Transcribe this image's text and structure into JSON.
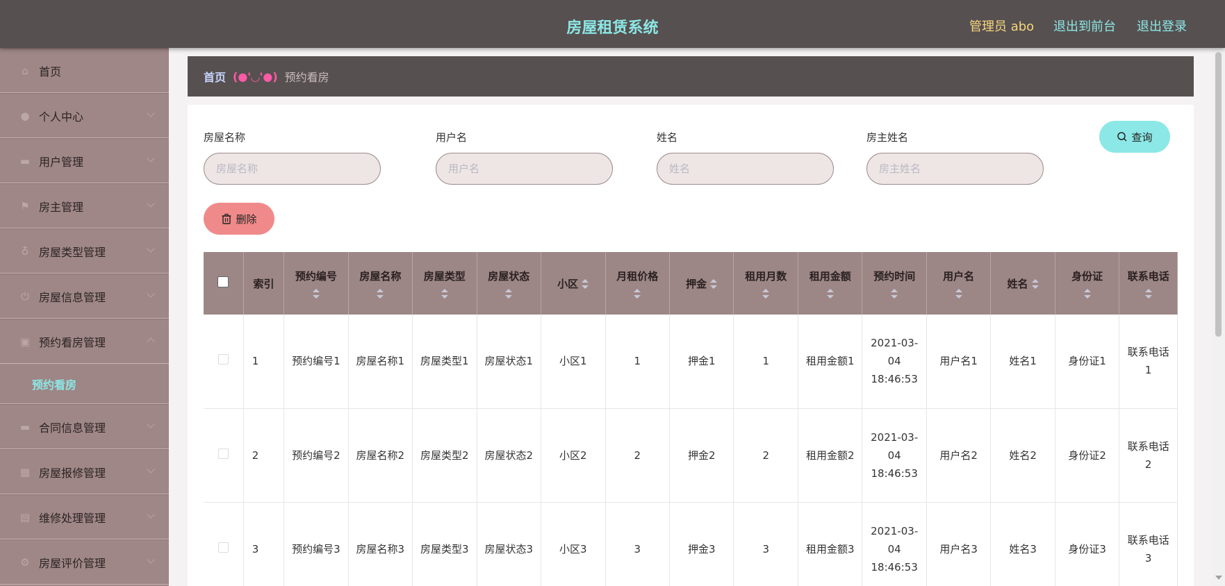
{
  "header": {
    "title": "房屋租赁系统",
    "admin": "管理员 abo",
    "exit_front": "退出到前台",
    "logout": "退出登录"
  },
  "sidebar": {
    "items": [
      {
        "label": "首页",
        "icon": "home-icon"
      },
      {
        "label": "个人中心",
        "icon": "user-icon"
      },
      {
        "label": "用户管理",
        "icon": "briefcase-icon"
      },
      {
        "label": "房主管理",
        "icon": "flag-icon"
      },
      {
        "label": "房屋类型管理",
        "icon": "mic-icon"
      },
      {
        "label": "房屋信息管理",
        "icon": "power-icon"
      },
      {
        "label": "预约看房管理",
        "icon": "clipboard-icon"
      },
      {
        "label": "合同信息管理",
        "icon": "chat-icon"
      },
      {
        "label": "房屋报修管理",
        "icon": "calendar-icon"
      },
      {
        "label": "维修处理管理",
        "icon": "table-icon"
      },
      {
        "label": "房屋评价管理",
        "icon": "settings-icon"
      }
    ],
    "subitem": "预约看房"
  },
  "breadcrumb": {
    "home": "首页",
    "separator": "(●'◡'●)",
    "current": "预约看房"
  },
  "search": {
    "fields": [
      {
        "label": "房屋名称",
        "placeholder": "房屋名称"
      },
      {
        "label": "用户名",
        "placeholder": "用户名"
      },
      {
        "label": "姓名",
        "placeholder": "姓名"
      },
      {
        "label": "房主姓名",
        "placeholder": "房主姓名"
      }
    ],
    "query_label": "查询",
    "delete_label": "删除"
  },
  "table": {
    "columns": [
      "索引",
      "预约编号",
      "房屋名称",
      "房屋类型",
      "房屋状态",
      "小区",
      "月租价格",
      "押金",
      "租用月数",
      "租用金额",
      "预约时间",
      "用户名",
      "姓名",
      "身份证",
      "联系电话"
    ],
    "rows": [
      [
        "1",
        "预约编号1",
        "房屋名称1",
        "房屋类型1",
        "房屋状态1",
        "小区1",
        "1",
        "押金1",
        "1",
        "租用金额1",
        "2021-03-04 18:46:53",
        "用户名1",
        "姓名1",
        "身份证1",
        "联系电话1"
      ],
      [
        "2",
        "预约编号2",
        "房屋名称2",
        "房屋类型2",
        "房屋状态2",
        "小区2",
        "2",
        "押金2",
        "2",
        "租用金额2",
        "2021-03-04 18:46:53",
        "用户名2",
        "姓名2",
        "身份证2",
        "联系电话2"
      ],
      [
        "3",
        "预约编号3",
        "房屋名称3",
        "房屋类型3",
        "房屋状态3",
        "小区3",
        "3",
        "押金3",
        "3",
        "租用金额3",
        "2021-03-04 18:46:53",
        "用户名3",
        "姓名3",
        "身份证3",
        "联系电话3"
      ]
    ]
  },
  "colors": {
    "header_bg": "#575050",
    "accent": "#8be8e6",
    "sidebar_bg": "#a08787",
    "table_header_bg": "#9c8686",
    "delete_button": "#f08a8a"
  }
}
